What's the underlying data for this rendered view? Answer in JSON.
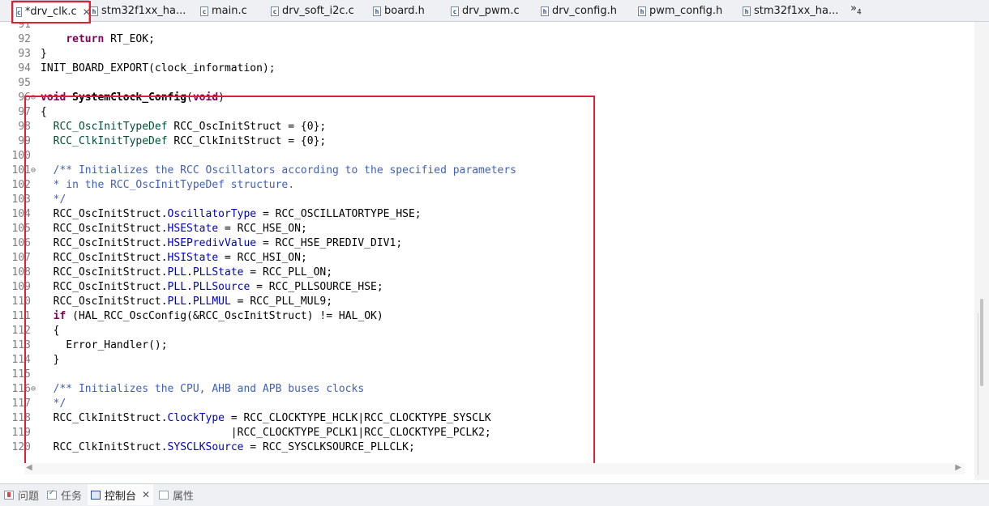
{
  "tabs": [
    {
      "label": "*drv_clk.c",
      "icon": "c-file-icon",
      "closable": true,
      "active": true
    },
    {
      "label": "stm32f1xx_ha...",
      "icon": "h-file-icon"
    },
    {
      "label": "main.c",
      "icon": "c-file-icon"
    },
    {
      "label": "drv_soft_i2c.c",
      "icon": "c-file-icon"
    },
    {
      "label": "board.h",
      "icon": "h-file-icon"
    },
    {
      "label": "drv_pwm.c",
      "icon": "c-file-icon"
    },
    {
      "label": "drv_config.h",
      "icon": "h-file-icon"
    },
    {
      "label": "pwm_config.h",
      "icon": "h-file-icon"
    },
    {
      "label": "stm32f1xx_ha...",
      "icon": "h-file-icon"
    }
  ],
  "tab_overflow": {
    "label": "»",
    "count": "4"
  },
  "code": [
    {
      "n": "91",
      "t": ""
    },
    {
      "n": "92",
      "t": "    return RT_EOK;"
    },
    {
      "n": "93",
      "t": "}"
    },
    {
      "n": "94",
      "t": "INIT_BOARD_EXPORT(clock_information);"
    },
    {
      "n": "95",
      "t": ""
    },
    {
      "n": "96",
      "t": "void SystemClock_Config(void)",
      "fold": true
    },
    {
      "n": "97",
      "t": "{"
    },
    {
      "n": "98",
      "t": "  RCC_OscInitTypeDef RCC_OscInitStruct = {0};"
    },
    {
      "n": "99",
      "t": "  RCC_ClkInitTypeDef RCC_ClkInitStruct = {0};"
    },
    {
      "n": "100",
      "t": ""
    },
    {
      "n": "101",
      "t": "  /** Initializes the RCC Oscillators according to the specified parameters",
      "fold": true
    },
    {
      "n": "102",
      "t": "  * in the RCC_OscInitTypeDef structure."
    },
    {
      "n": "103",
      "t": "  */"
    },
    {
      "n": "104",
      "t": "  RCC_OscInitStruct.OscillatorType = RCC_OSCILLATORTYPE_HSE;"
    },
    {
      "n": "105",
      "t": "  RCC_OscInitStruct.HSEState = RCC_HSE_ON;"
    },
    {
      "n": "106",
      "t": "  RCC_OscInitStruct.HSEPredivValue = RCC_HSE_PREDIV_DIV1;"
    },
    {
      "n": "107",
      "t": "  RCC_OscInitStruct.HSIState = RCC_HSI_ON;"
    },
    {
      "n": "108",
      "t": "  RCC_OscInitStruct.PLL.PLLState = RCC_PLL_ON;"
    },
    {
      "n": "109",
      "t": "  RCC_OscInitStruct.PLL.PLLSource = RCC_PLLSOURCE_HSE;"
    },
    {
      "n": "110",
      "t": "  RCC_OscInitStruct.PLL.PLLMUL = RCC_PLL_MUL9;"
    },
    {
      "n": "111",
      "t": "  if (HAL_RCC_OscConfig(&RCC_OscInitStruct) != HAL_OK)"
    },
    {
      "n": "112",
      "t": "  {"
    },
    {
      "n": "113",
      "t": "    Error_Handler();"
    },
    {
      "n": "114",
      "t": "  }"
    },
    {
      "n": "115",
      "t": ""
    },
    {
      "n": "116",
      "t": "  /** Initializes the CPU, AHB and APB buses clocks",
      "fold": true
    },
    {
      "n": "117",
      "t": "  */"
    },
    {
      "n": "118",
      "t": "  RCC_ClkInitStruct.ClockType = RCC_CLOCKTYPE_HCLK|RCC_CLOCKTYPE_SYSCLK"
    },
    {
      "n": "119",
      "t": "                              |RCC_CLOCKTYPE_PCLK1|RCC_CLOCKTYPE_PCLK2;"
    },
    {
      "n": "120",
      "t": "  RCC_ClkInitStruct.SYSCLKSource = RCC_SYSCLKSOURCE_PLLCLK;"
    }
  ],
  "bottom_tabs": [
    {
      "label": "问题",
      "icon": "problems-icon"
    },
    {
      "label": "任务",
      "icon": "tasks-icon"
    },
    {
      "label": "控制台",
      "icon": "console-icon",
      "active": true,
      "closable": true
    },
    {
      "label": "属性",
      "icon": "properties-icon"
    }
  ],
  "colors": {
    "keyword": "#7f0055",
    "type": "#005032",
    "field": "#0000c0",
    "comment": "#3f5fbf",
    "highlight": "#e0202e"
  }
}
